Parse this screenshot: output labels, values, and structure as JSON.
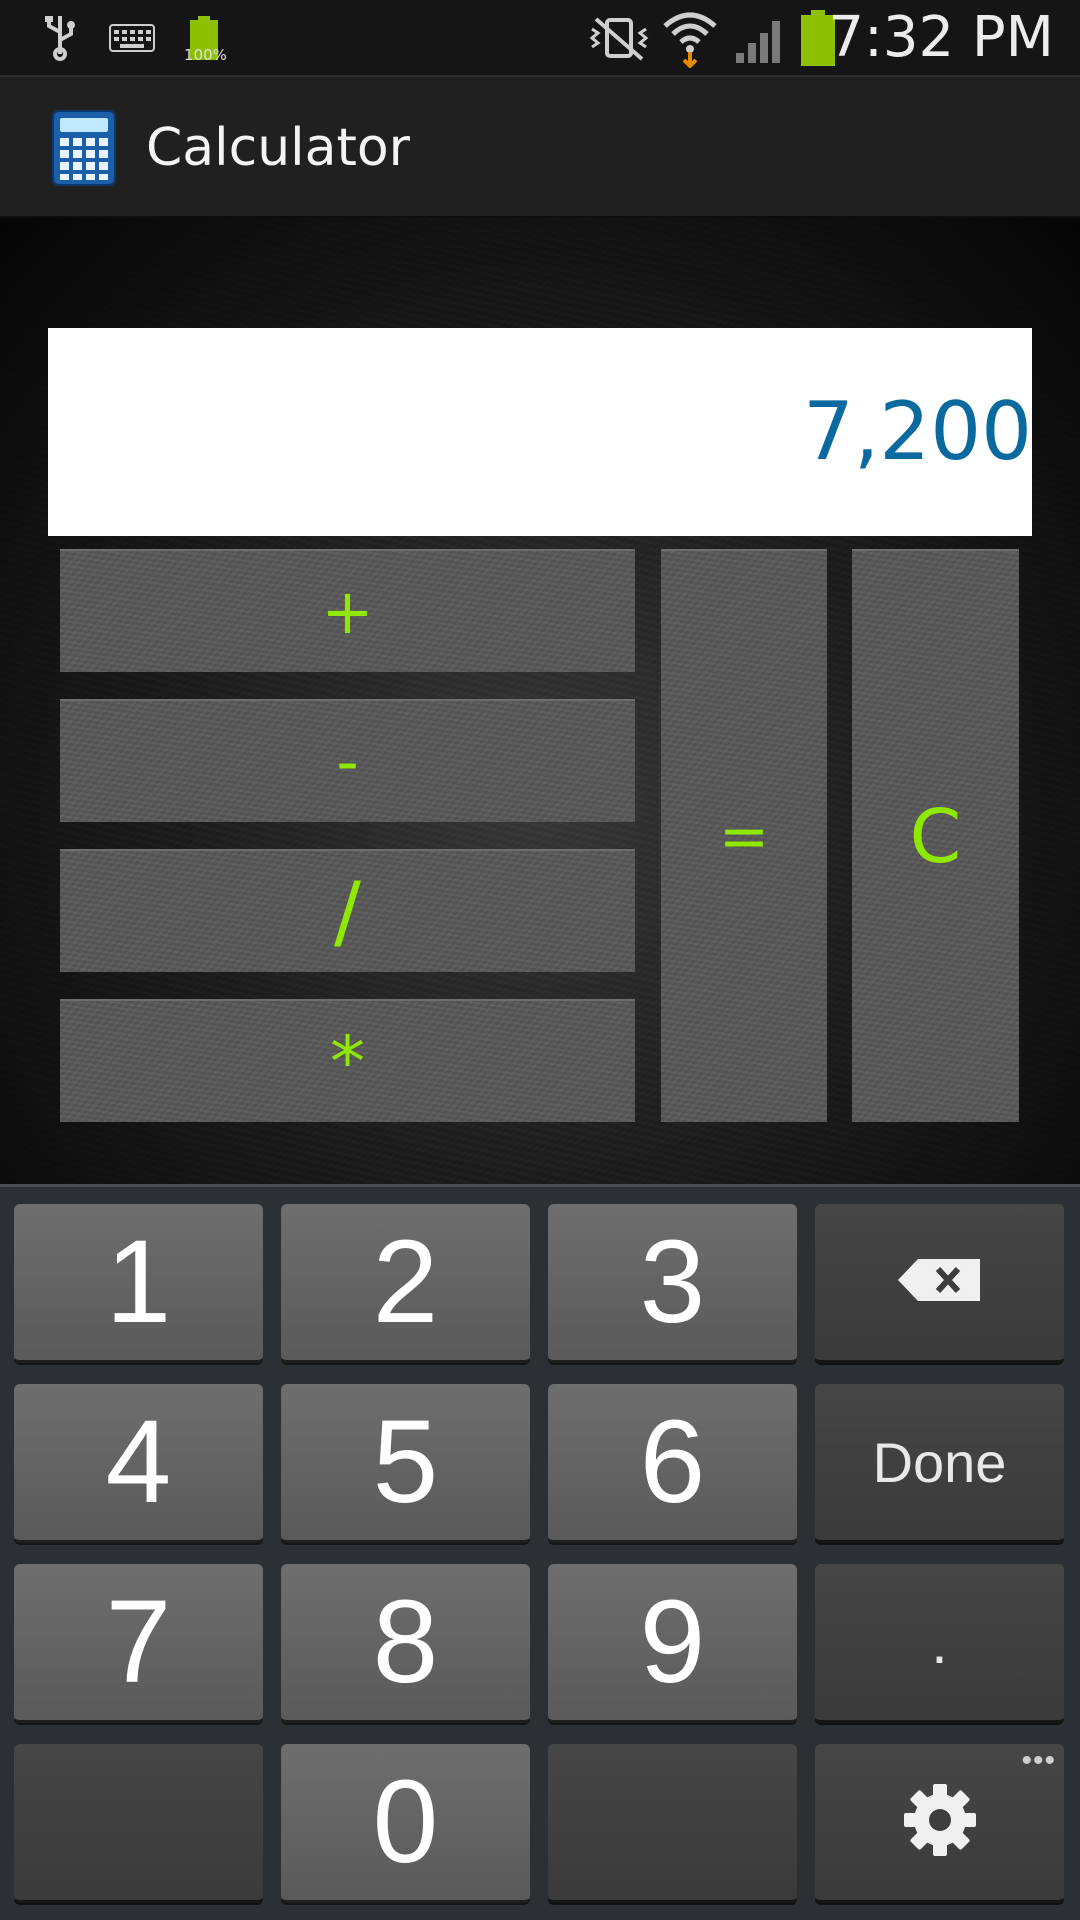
{
  "status_bar": {
    "time": "7:32 PM",
    "battery_small_label": "100%",
    "icons": [
      "usb-icon",
      "keyboard-icon",
      "battery-small-icon",
      "vibrate-mute-icon",
      "wifi-icon",
      "signal-icon",
      "battery-icon"
    ]
  },
  "action_bar": {
    "title": "Calculator",
    "icon": "calculator-icon"
  },
  "display": {
    "value": "7,200"
  },
  "operators": {
    "plus": "+",
    "minus": "-",
    "divide": "/",
    "multiply": "*",
    "equals": "=",
    "clear": "C"
  },
  "keyboard": {
    "keys": {
      "k1": "1",
      "k2": "2",
      "k3": "3",
      "k4": "4",
      "k5": "5",
      "k6": "6",
      "k7": "7",
      "k8": "8",
      "k9": "9",
      "k0": "0",
      "done": "Done",
      "dot": ".",
      "more": "•••"
    },
    "backspace_icon": "backspace-icon",
    "settings_icon": "gear-icon"
  },
  "colors": {
    "operator_text": "#8fe800",
    "display_text": "#0a6aa0",
    "statusbar_bg": "#151515",
    "actionbar_bg": "#202020",
    "keyboard_bg": "#2c2f33"
  }
}
